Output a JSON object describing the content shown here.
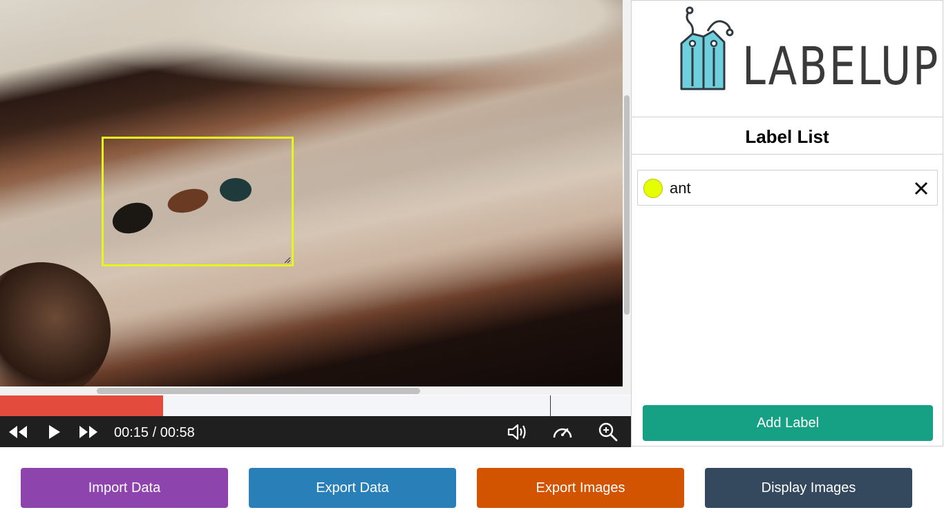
{
  "player": {
    "time_display": "00:15 / 00:58",
    "current_time": "00:15",
    "duration": "00:58",
    "progress_fraction": 0.259,
    "icons": {
      "rewind": "rewind-icon",
      "play": "play-icon",
      "forward": "fast-forward-icon",
      "volume": "volume-icon",
      "speed": "speedometer-icon",
      "zoom": "zoom-in-icon"
    }
  },
  "annotation": {
    "label": "ant",
    "color": "#e6f51b"
  },
  "logo": {
    "text": "LABELUP"
  },
  "label_panel": {
    "title": "Label List",
    "labels": [
      {
        "name": "ant",
        "color": "#e6ff00"
      }
    ],
    "add_label": "Add Label"
  },
  "actions": {
    "import_data": {
      "label": "Import Data",
      "color": "#8e44ad"
    },
    "export_data": {
      "label": "Export Data",
      "color": "#2980b9"
    },
    "export_images": {
      "label": "Export Images",
      "color": "#d35400"
    },
    "display_images": {
      "label": "Display Images",
      "color": "#34495e"
    }
  },
  "colors": {
    "timeline_played": "#e34b3d",
    "controls_bg": "#1f1f1f",
    "add_label_bg": "#17a184",
    "logo_tag": "#6fcfdc"
  }
}
